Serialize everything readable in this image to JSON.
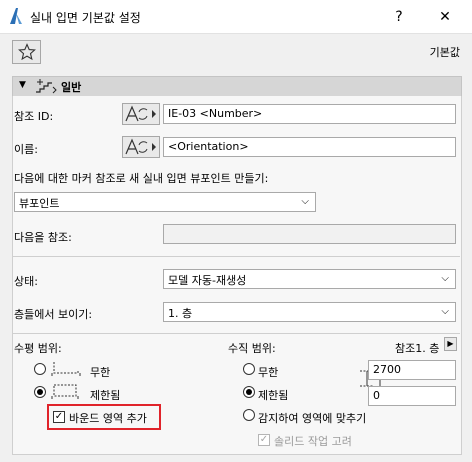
{
  "window": {
    "title": "실내 입면 기본값 설정",
    "help_label": "?",
    "close_label": "✕"
  },
  "toolbar": {
    "favorites_icon": "star-icon",
    "defaults_label": "기본값"
  },
  "section": {
    "title": "일반"
  },
  "fields": {
    "ref_id_label": "참조 ID:",
    "ref_id_value": "IE-03 <Number>",
    "name_label": "이름:",
    "name_value": "<Orientation>",
    "marker_ref_label": "다음에 대한 마커 참조로 새 실내 입면 뷰포인트 만들기:",
    "marker_ref_value": "뷰포인트",
    "ref_to_label": "다음을 참조:",
    "ref_to_value": "",
    "status_label": "상태:",
    "status_value": "모델 자동-재생성",
    "show_on_stories_label": "층들에서 보이기:",
    "show_on_stories_value": "1. 층"
  },
  "horizontal_range": {
    "label": "수평 범위:",
    "options": [
      {
        "label": "무한",
        "selected": false
      },
      {
        "label": "제한됨",
        "selected": true
      }
    ],
    "add_bounds_label": "바운드 영역 추가",
    "add_bounds_checked": true
  },
  "vertical_range": {
    "label": "수직 범위:",
    "ref_label": "참조1. 층",
    "options": [
      {
        "label": "무한",
        "selected": false
      },
      {
        "label": "제한됨",
        "selected": true
      },
      {
        "label": "감지하여 영역에 맞추기",
        "selected": false
      }
    ],
    "upper_value": "2700",
    "lower_value": "0",
    "solid_ops_label": "솔리드 작업 고려",
    "solid_ops_checked": true,
    "accent_color": "#e0232a"
  }
}
